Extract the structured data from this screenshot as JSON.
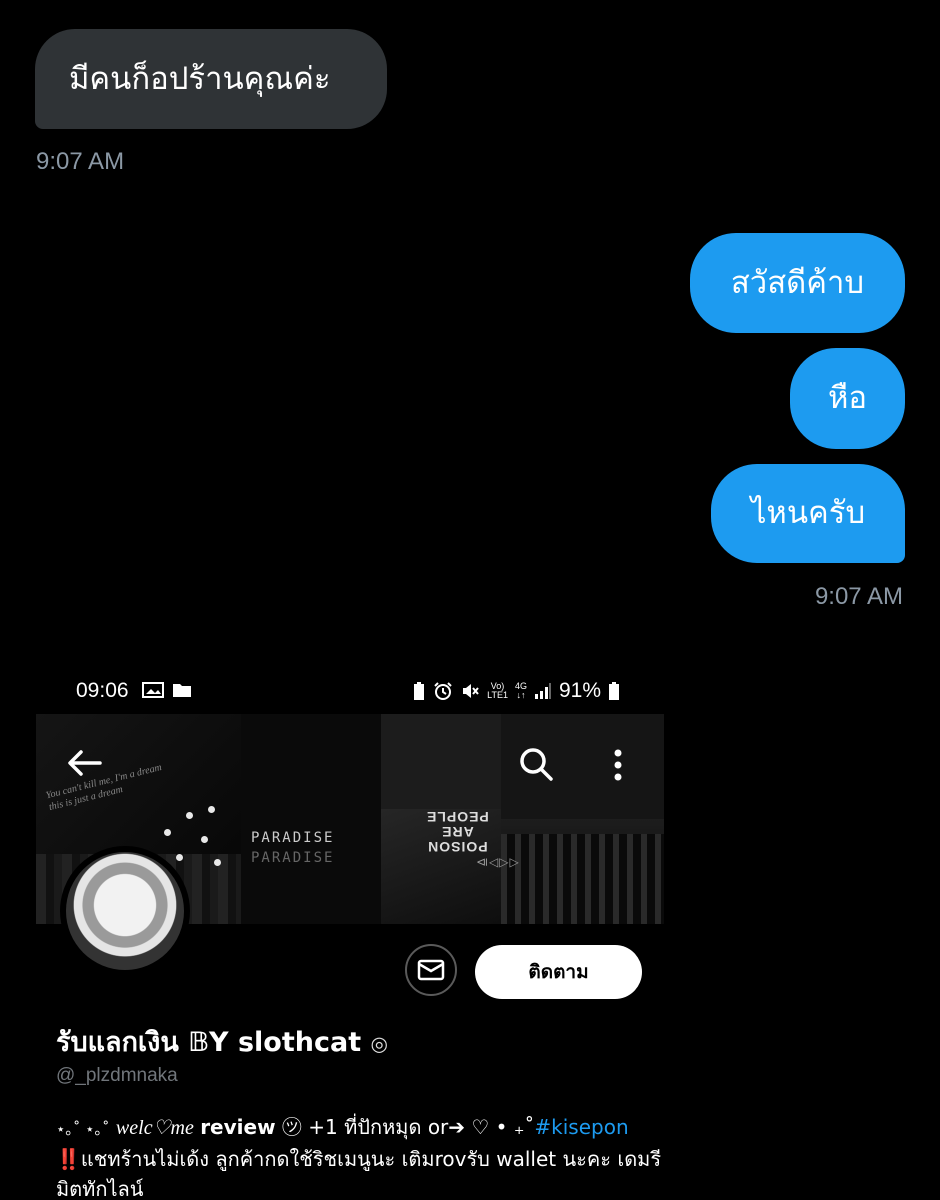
{
  "chat": {
    "received": {
      "text": "มีคนก็อปร้านคุณค่ะ",
      "time": "9:07 AM"
    },
    "sent": [
      {
        "text": "สวัสดีค้าบ"
      },
      {
        "text": "หือ"
      },
      {
        "text": "ไหนครับ"
      }
    ],
    "sent_time": "9:07 AM"
  },
  "attachment": {
    "status_bar": {
      "time": "09:06",
      "network_top": "Vo)",
      "network_bottom": "LTE1",
      "net4g": "4G",
      "battery": "91%"
    },
    "banner": {
      "scribble_line1": "You can't kill me, I'm a dream",
      "scribble_line2": "this is just a dream",
      "paradise_1": "PARADISE",
      "paradise_2": "PARADISE",
      "poison_1": "PEOPLE",
      "poison_2": "ARE",
      "poison_3": "POISON",
      "media_controls": "⧏◁▷▷"
    },
    "profile": {
      "follow_label": "ติดตาม",
      "display_name": "รับแลกเงิน 𝔹Y slothcat",
      "badge": "◎",
      "handle": "@_plzdmnaka",
      "bio_deco_1": "⋆｡˚ ⋆｡˚",
      "bio_welcome": "welc♡me",
      "bio_review": "review",
      "bio_after_review": "㋡ +1 ที่ปักหมุด or➔ ♡ • ₊˚",
      "bio_hashtag": "#kisepon",
      "bio_alert": "‼️",
      "bio_line2": "แชทร้านไม่เด้ง ลูกค้ากดใช้ริชเมนูนะ เติมrovรับ wallet นะคะ เดมรี",
      "bio_line3": "มิตทักไลน์"
    }
  },
  "colors": {
    "background": "#000000",
    "sent_bubble": "#1d9bf0",
    "received_bubble": "#2f3336",
    "timestamp": "#8b98a5"
  }
}
